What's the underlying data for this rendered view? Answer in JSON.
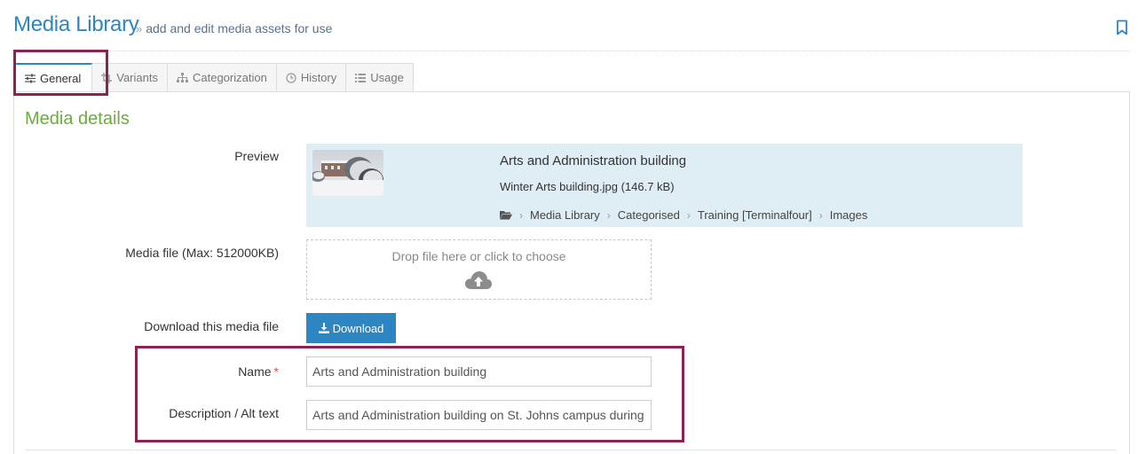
{
  "header": {
    "title": "Media Library",
    "subtitle": "add and edit media assets for use",
    "subtitle_prefix": "»",
    "bookmark_icon": "bookmark-icon"
  },
  "tabs": [
    {
      "label": "General",
      "icon": "sliders-icon",
      "active": true
    },
    {
      "label": "Variants",
      "icon": "crop-icon",
      "active": false
    },
    {
      "label": "Categorization",
      "icon": "sitemap-icon",
      "active": false
    },
    {
      "label": "History",
      "icon": "clock-icon",
      "active": false
    },
    {
      "label": "Usage",
      "icon": "list-icon",
      "active": false
    }
  ],
  "section": {
    "title": "Media details"
  },
  "preview": {
    "label": "Preview",
    "name": "Arts and Administration building",
    "file": "Winter Arts building.jpg (146.7 kB)",
    "breadcrumb": [
      "Media Library",
      "Categorised",
      "Training [Terminalfour]",
      "Images"
    ],
    "breadcrumb_sep": "›",
    "folder_icon": "folder-open-icon"
  },
  "media_file": {
    "label": "Media file (Max: 512000KB)",
    "dropzone_text": "Drop file here or click to choose",
    "upload_icon": "cloud-upload-icon"
  },
  "download": {
    "label": "Download this media file",
    "button_label": "Download",
    "icon": "download-icon"
  },
  "name_field": {
    "label": "Name",
    "required_mark": "*",
    "value": "Arts and Administration building"
  },
  "description_field": {
    "label": "Description / Alt text",
    "value": "Arts and Administration building on St. Johns campus during winter"
  },
  "colors": {
    "primary": "#2d86c2",
    "section_title": "#6aad3f",
    "preview_bg": "#dfedf5",
    "highlight": "#8b2252",
    "required": "#d9534f"
  }
}
